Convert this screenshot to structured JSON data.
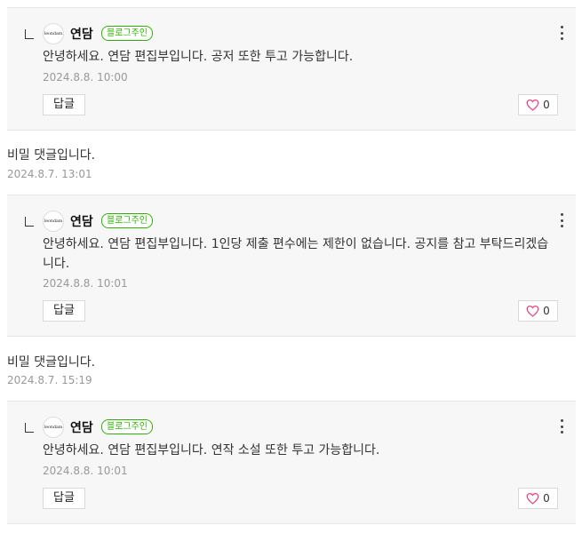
{
  "replies": [
    {
      "avatar_text": "leondam",
      "author": "연담",
      "badge": "블로그주인",
      "text": "안녕하세요. 연담 편집부입니다. 공저 또한 투고 가능합니다.",
      "date": "2024.8.8. 10:00",
      "reply_label": "답글",
      "likes": "0"
    },
    {
      "avatar_text": "leondam",
      "author": "연담",
      "badge": "블로그주인",
      "text": "안녕하세요. 연담 편집부입니다. 1인당 제출 편수에는 제한이 없습니다. 공지를 참고 부탁드리겠습니다.",
      "date": "2024.8.8. 10:01",
      "reply_label": "답글",
      "likes": "0"
    },
    {
      "avatar_text": "leondam",
      "author": "연담",
      "badge": "블로그주인",
      "text": "안녕하세요. 연담 편집부입니다. 연작 소설 또한 투고 가능합니다.",
      "date": "2024.8.8. 10:01",
      "reply_label": "답글",
      "likes": "0"
    }
  ],
  "secret_comments": [
    {
      "text": "비밀 댓글입니다.",
      "date": "2024.8.7. 13:01"
    },
    {
      "text": "비밀 댓글입니다.",
      "date": "2024.8.7. 15:19"
    }
  ],
  "colors": {
    "accent_green": "#2db400",
    "heart_pink": "#e8417f",
    "reply_bg": "#f7f7f7"
  },
  "icons": {
    "reply": "reply-arrow-icon",
    "more": "more-vertical-icon",
    "like": "heart-icon"
  }
}
